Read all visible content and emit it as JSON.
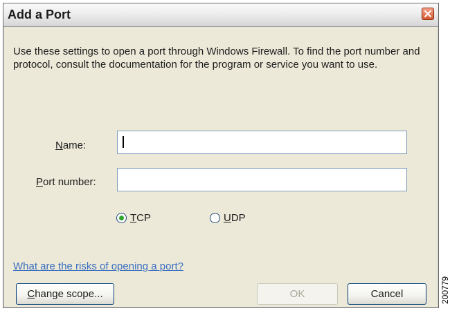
{
  "window": {
    "title": "Add a Port",
    "close_icon": "close-icon"
  },
  "description": "Use these settings to open a port through Windows Firewall. To find the port number and protocol, consult the documentation for the program or service you want to use.",
  "fields": {
    "name": {
      "label_accel": "N",
      "label_rest": "ame:",
      "value": ""
    },
    "port_number": {
      "label_accel": "P",
      "label_rest": "ort number:",
      "value": ""
    }
  },
  "protocol": {
    "selected": "TCP",
    "options": [
      {
        "accel": "T",
        "rest": "CP",
        "selected": true
      },
      {
        "accel": "U",
        "rest": "DP",
        "selected": false
      }
    ]
  },
  "link": {
    "text": "What are the risks of opening a port?",
    "color": "#3a6fbf"
  },
  "buttons": {
    "change_scope": {
      "accel": "C",
      "rest": "hange scope..."
    },
    "ok": {
      "label": "OK",
      "enabled": false
    },
    "cancel": {
      "label": "Cancel"
    }
  },
  "figure_number": "200779",
  "colors": {
    "dialog_bg": "#ece9d8",
    "radio_selected": "#2fa42f",
    "close_button": "#d65a32"
  }
}
